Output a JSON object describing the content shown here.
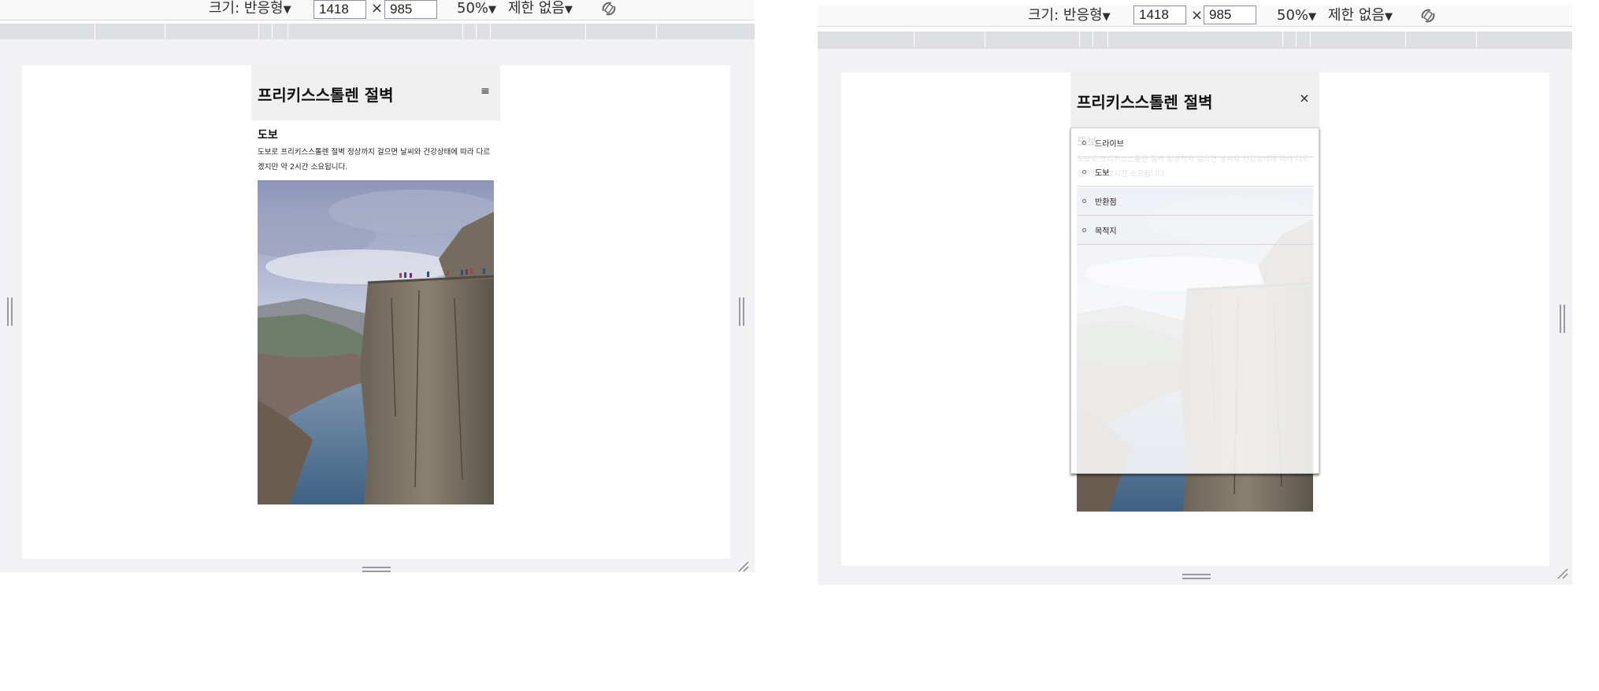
{
  "devtools": {
    "size_label": "크기: 반응형",
    "width_value": "1418",
    "times_sign": "×",
    "height_value": "985",
    "zoom_label": "50%",
    "throttle_label": "제한 없음",
    "dropdown_arrow": "▼"
  },
  "site": {
    "title": "프리키스스톨렌 절벽",
    "menu_icon": "≡",
    "close_icon": "×",
    "section": {
      "heading": "도보",
      "text": "도보로 프리키스스톨렌 절벽 정상까지 걸으면 날씨와 건강상태에 따라 다르겠지만 약 2시간 소요됩니다."
    },
    "nav_items": [
      {
        "label": "드라이브"
      },
      {
        "label": "도보"
      },
      {
        "label": "반환점"
      },
      {
        "label": "목적지"
      }
    ]
  },
  "colors": {
    "toolbar_bg": "#f9f9fa",
    "ruler_bg": "#dedfe3",
    "viewport_bg": "#f2f2f4",
    "header_bg": "#efefef"
  },
  "icons": {
    "menu": "hamburger-menu-icon",
    "close": "close-icon",
    "rotate": "rotate-viewport-icon"
  }
}
